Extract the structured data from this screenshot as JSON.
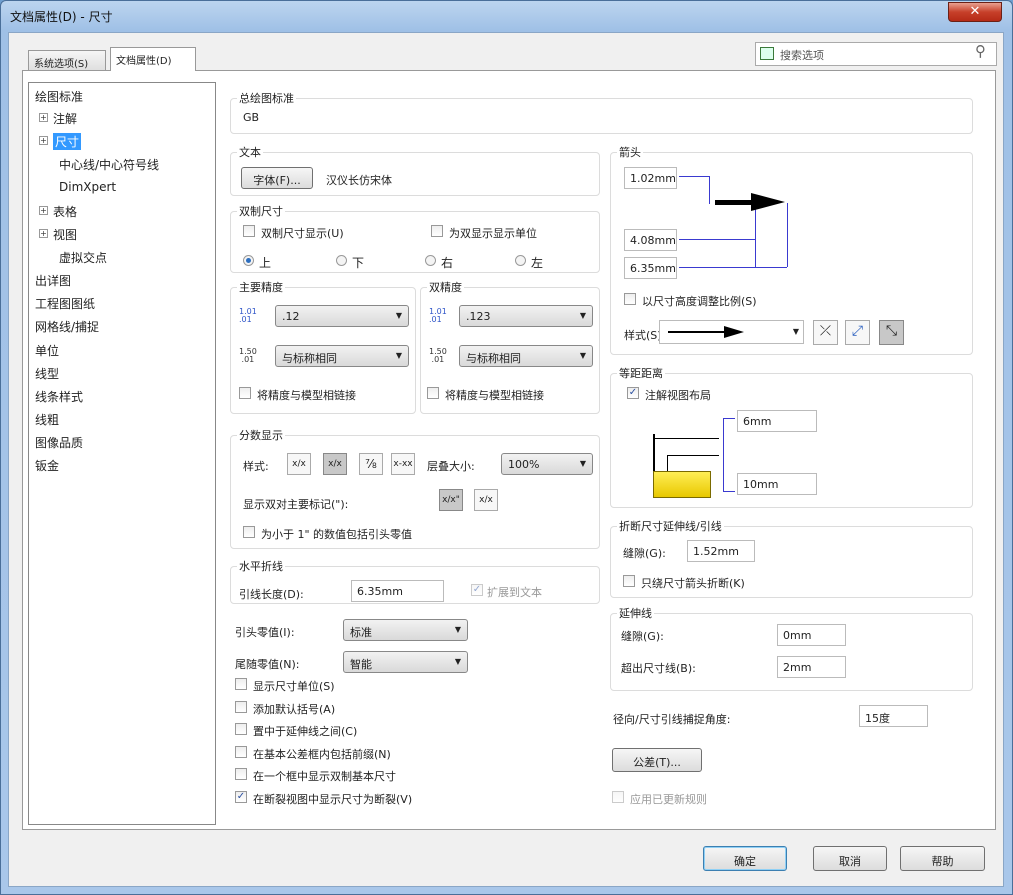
{
  "window": {
    "title": "文档属性(D) - 尺寸",
    "close": "✕"
  },
  "tabs": [
    {
      "label": "系统选项(S)"
    },
    {
      "label": "文档属性(D)"
    }
  ],
  "search": {
    "placeholder": "搜索选项"
  },
  "tree": [
    "绘图标准",
    "注解",
    "尺寸",
    "中心线/中心符号线",
    "DimXpert",
    "表格",
    "视图",
    "虚拟交点",
    "出详图",
    "工程图图纸",
    "网格线/捕捉",
    "单位",
    "线型",
    "线条样式",
    "线粗",
    "图像品质",
    "钣金"
  ],
  "overall": {
    "title": "总绘图标准",
    "value": "GB"
  },
  "text": {
    "title": "文本",
    "font_button": "字体(F)...",
    "font_name": "汉仪长仿宋体"
  },
  "dual": {
    "title": "双制尺寸",
    "show": "双制尺寸显示(U)",
    "show_units": "为双显示显示单位",
    "top": "上",
    "bottom": "下",
    "right": "右",
    "left": "左"
  },
  "primary": {
    "title": "主要精度",
    "value": ".12",
    "tol": "与标称相同",
    "link": "将精度与模型相链接"
  },
  "dualprec": {
    "title": "双精度",
    "value": ".123",
    "tol": "与标称相同",
    "link": "将精度与模型相链接"
  },
  "fraction": {
    "title": "分数显示",
    "style": "样式:",
    "stack": "层叠大小:",
    "stack_value": "100%",
    "dual_mark": "显示双对主要标记(\"):",
    "lead_zero": "为小于 1\" 的数值包括引头零值",
    "b1": "x/x",
    "b2": "x/x",
    "b3": "⅞",
    "b4": "x-xx",
    "b5": "x/x\"",
    "b6": "x/x"
  },
  "bent": {
    "title": "水平折线",
    "leader_len": "引线长度(D):",
    "leader_value": "6.35mm",
    "extend": "扩展到文本"
  },
  "zeros": {
    "leading": "引头零值(I):",
    "leading_value": "标准",
    "trailing": "尾随零值(N):",
    "trailing_value": "智能"
  },
  "checks": [
    {
      "label": "显示尺寸单位(S)",
      "checked": false
    },
    {
      "label": "添加默认括号(A)",
      "checked": false
    },
    {
      "label": "置中于延伸线之间(C)",
      "checked": false
    },
    {
      "label": "在基本公差框内包括前缀(N)",
      "checked": false
    },
    {
      "label": "在一个框中显示双制基本尺寸",
      "checked": false
    },
    {
      "label": "在断裂视图中显示尺寸为断裂(V)",
      "checked": true
    }
  ],
  "arrows": {
    "title": "箭头",
    "v1": "1.02mm",
    "v2": "4.08mm",
    "v3": "6.35mm",
    "scale": "以尺寸高度调整比例(S)",
    "style": "样式(S):"
  },
  "offset": {
    "title": "等距距离",
    "layout": "注解视图布局",
    "v1": "6mm",
    "v2": "10mm"
  },
  "breakl": {
    "title": "折断尺寸延伸线/引线",
    "gap": "缝隙(G):",
    "gap_value": "1.52mm",
    "only": "只绕尺寸箭头折断(K)"
  },
  "ext": {
    "title": "延伸线",
    "gap": "缝隙(G):",
    "gap_value": "0mm",
    "beyond": "超出尺寸线(B):",
    "beyond_value": "2mm"
  },
  "radial": {
    "label": "径向/尺寸引线捕捉角度:",
    "value": "15度"
  },
  "tol_button": "公差(T)...",
  "apply_rules": "应用已更新规则",
  "buttons": {
    "ok": "确定",
    "cancel": "取消",
    "help": "帮助"
  }
}
